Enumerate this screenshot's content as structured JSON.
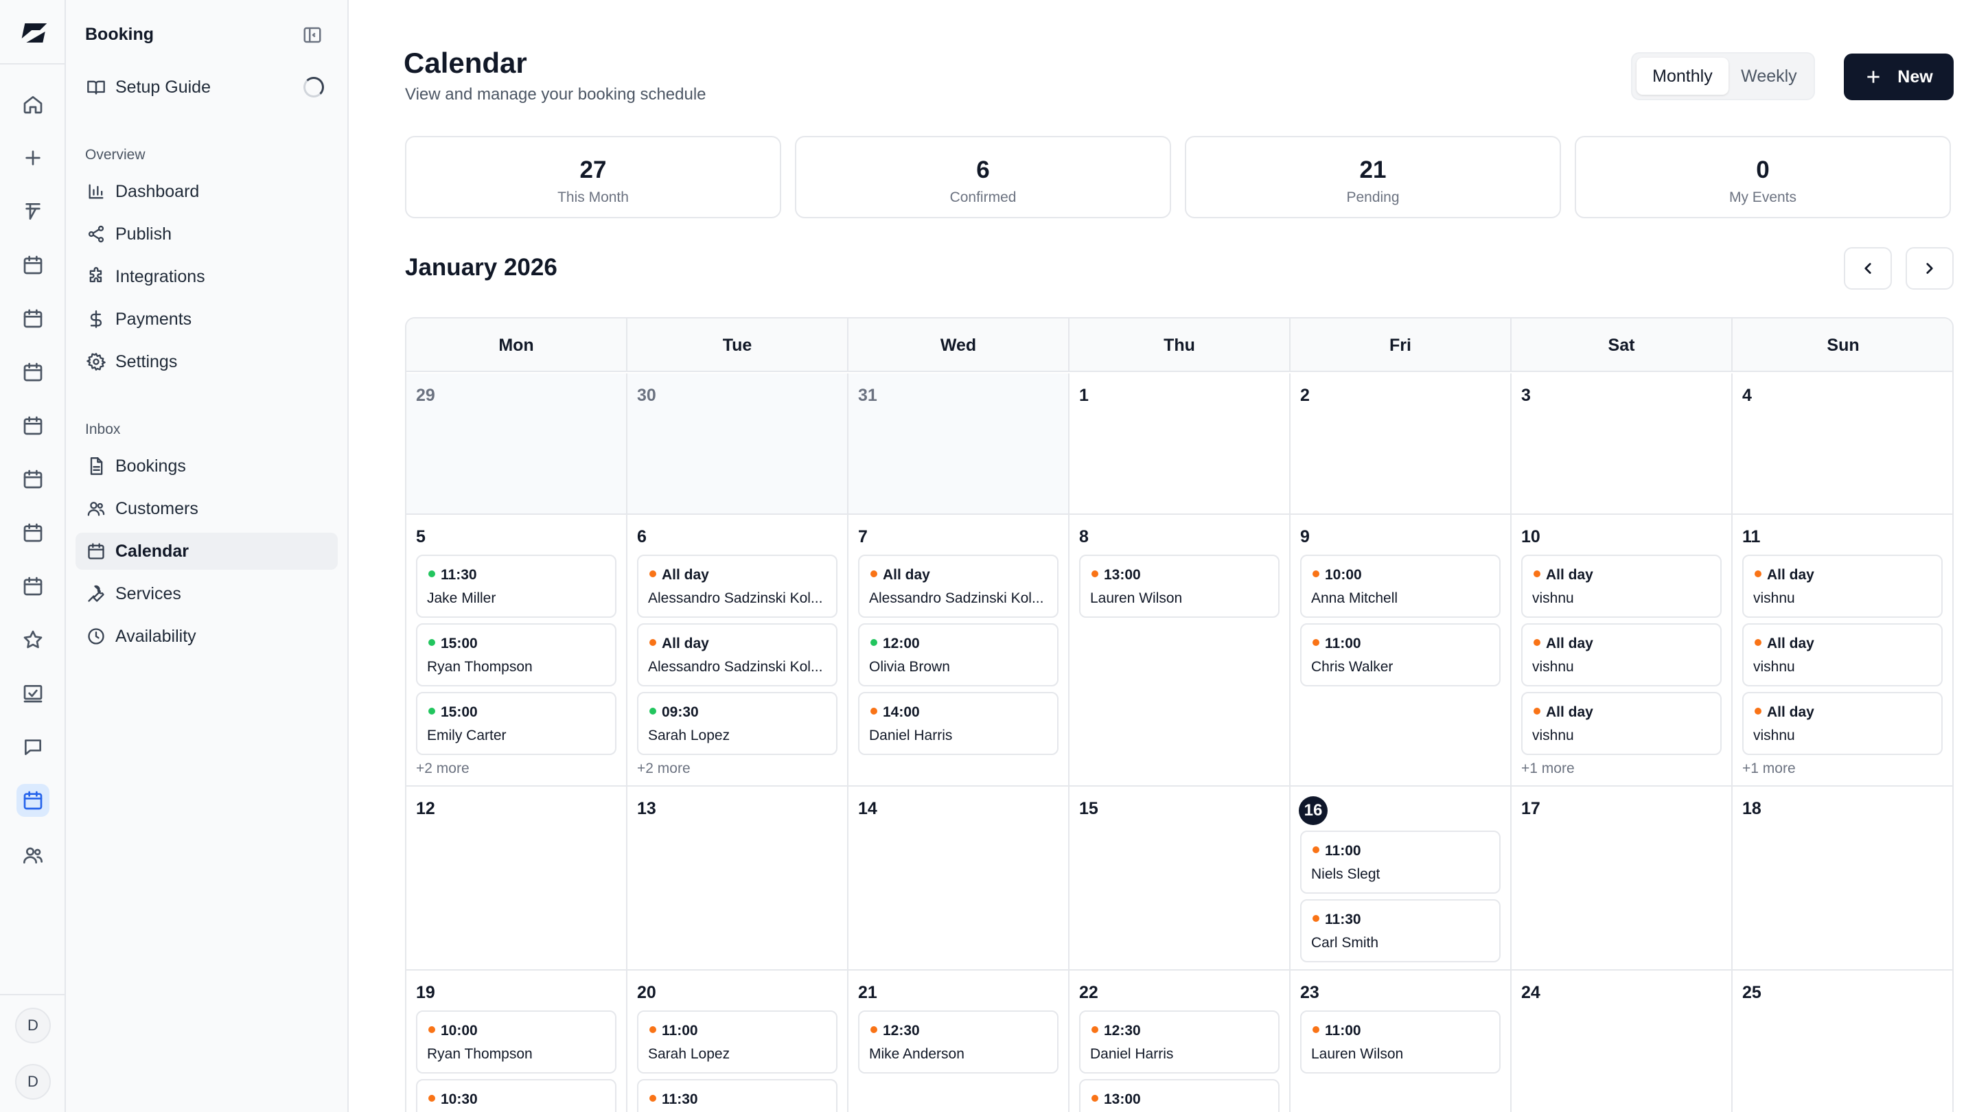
{
  "colors": {
    "confirmed": "#22c55e",
    "pending": "#f97316",
    "accent": "#2563eb",
    "primary_button": "#0f172a"
  },
  "rail": {
    "icons": [
      "home-icon",
      "plus-icon",
      "form-icon",
      "calendar-icon",
      "calendar-icon",
      "calendar-icon",
      "calendar-icon",
      "calendar-icon",
      "calendar-icon",
      "calendar-icon",
      "star-icon",
      "chart-check-icon",
      "message-icon",
      "calendar-icon",
      "users-icon"
    ],
    "active_index": 13,
    "avatars": [
      "D",
      "D"
    ]
  },
  "sidebar": {
    "title": "Booking",
    "setup_guide": "Setup Guide",
    "overview_label": "Overview",
    "overview_items": [
      {
        "label": "Dashboard",
        "icon": "bar-chart-icon"
      },
      {
        "label": "Publish",
        "icon": "share-icon"
      },
      {
        "label": "Integrations",
        "icon": "puzzle-icon"
      },
      {
        "label": "Payments",
        "icon": "dollar-icon"
      },
      {
        "label": "Settings",
        "icon": "gear-icon"
      }
    ],
    "inbox_label": "Inbox",
    "inbox_items": [
      {
        "label": "Bookings",
        "icon": "document-icon"
      },
      {
        "label": "Customers",
        "icon": "users-icon"
      },
      {
        "label": "Calendar",
        "icon": "calendar-icon",
        "active": true
      },
      {
        "label": "Services",
        "icon": "wrench-icon"
      },
      {
        "label": "Availability",
        "icon": "clock-icon"
      }
    ]
  },
  "header": {
    "title": "Calendar",
    "subtitle": "View and manage your booking schedule",
    "view_options": [
      "Monthly",
      "Weekly"
    ],
    "active_view": "Monthly",
    "new_label": "New"
  },
  "stats": [
    {
      "value": "27",
      "label": "This Month"
    },
    {
      "value": "6",
      "label": "Confirmed"
    },
    {
      "value": "21",
      "label": "Pending"
    },
    {
      "value": "0",
      "label": "My Events"
    }
  ],
  "calendar": {
    "month_title": "January 2026",
    "weekdays": [
      "Mon",
      "Tue",
      "Wed",
      "Thu",
      "Fri",
      "Sat",
      "Sun"
    ],
    "today": "16",
    "weeks": [
      [
        {
          "day": "29",
          "outside": true,
          "events": []
        },
        {
          "day": "30",
          "outside": true,
          "events": []
        },
        {
          "day": "31",
          "outside": true,
          "events": []
        },
        {
          "day": "1",
          "events": []
        },
        {
          "day": "2",
          "events": []
        },
        {
          "day": "3",
          "events": []
        },
        {
          "day": "4",
          "events": []
        }
      ],
      [
        {
          "day": "5",
          "events": [
            {
              "time": "11:30",
              "name": "Jake Miller",
              "status": "confirmed"
            },
            {
              "time": "15:00",
              "name": "Ryan Thompson",
              "status": "confirmed"
            },
            {
              "time": "15:00",
              "name": "Emily Carter",
              "status": "confirmed"
            }
          ],
          "more": "+2 more"
        },
        {
          "day": "6",
          "events": [
            {
              "time": "All day",
              "name": "Alessandro Sadzinski Kol...",
              "status": "pending"
            },
            {
              "time": "All day",
              "name": "Alessandro Sadzinski Kol...",
              "status": "pending"
            },
            {
              "time": "09:30",
              "name": "Sarah Lopez",
              "status": "confirmed"
            }
          ],
          "more": "+2 more"
        },
        {
          "day": "7",
          "events": [
            {
              "time": "All day",
              "name": "Alessandro Sadzinski Kol...",
              "status": "pending"
            },
            {
              "time": "12:00",
              "name": "Olivia Brown",
              "status": "confirmed"
            },
            {
              "time": "14:00",
              "name": "Daniel Harris",
              "status": "pending"
            }
          ]
        },
        {
          "day": "8",
          "events": [
            {
              "time": "13:00",
              "name": "Lauren Wilson",
              "status": "pending"
            }
          ]
        },
        {
          "day": "9",
          "events": [
            {
              "time": "10:00",
              "name": "Anna Mitchell",
              "status": "pending"
            },
            {
              "time": "11:00",
              "name": "Chris Walker",
              "status": "pending"
            }
          ]
        },
        {
          "day": "10",
          "events": [
            {
              "time": "All day",
              "name": "vishnu",
              "status": "pending"
            },
            {
              "time": "All day",
              "name": "vishnu",
              "status": "pending"
            },
            {
              "time": "All day",
              "name": "vishnu",
              "status": "pending"
            }
          ],
          "more": "+1 more"
        },
        {
          "day": "11",
          "events": [
            {
              "time": "All day",
              "name": "vishnu",
              "status": "pending"
            },
            {
              "time": "All day",
              "name": "vishnu",
              "status": "pending"
            },
            {
              "time": "All day",
              "name": "vishnu",
              "status": "pending"
            }
          ],
          "more": "+1 more"
        }
      ],
      [
        {
          "day": "12",
          "events": []
        },
        {
          "day": "13",
          "events": []
        },
        {
          "day": "14",
          "events": []
        },
        {
          "day": "15",
          "events": []
        },
        {
          "day": "16",
          "events": [
            {
              "time": "11:00",
              "name": "Niels Slegt",
              "status": "pending"
            },
            {
              "time": "11:30",
              "name": "Carl Smith",
              "status": "pending"
            }
          ]
        },
        {
          "day": "17",
          "events": []
        },
        {
          "day": "18",
          "events": []
        }
      ],
      [
        {
          "day": "19",
          "events": [
            {
              "time": "10:00",
              "name": "Ryan Thompson",
              "status": "pending"
            },
            {
              "time": "10:30",
              "name": "",
              "status": "pending"
            }
          ]
        },
        {
          "day": "20",
          "events": [
            {
              "time": "11:00",
              "name": "Sarah Lopez",
              "status": "pending"
            },
            {
              "time": "11:30",
              "name": "",
              "status": "pending"
            }
          ]
        },
        {
          "day": "21",
          "events": [
            {
              "time": "12:30",
              "name": "Mike Anderson",
              "status": "pending"
            }
          ]
        },
        {
          "day": "22",
          "events": [
            {
              "time": "12:30",
              "name": "Daniel Harris",
              "status": "pending"
            },
            {
              "time": "13:00",
              "name": "",
              "status": "pending"
            }
          ]
        },
        {
          "day": "23",
          "events": [
            {
              "time": "11:00",
              "name": "Lauren Wilson",
              "status": "pending"
            }
          ]
        },
        {
          "day": "24",
          "events": []
        },
        {
          "day": "25",
          "events": []
        }
      ]
    ]
  }
}
